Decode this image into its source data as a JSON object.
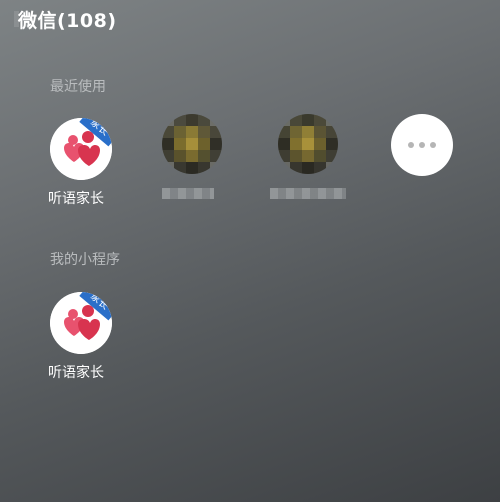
{
  "header": {
    "title": "微信(108)"
  },
  "recent": {
    "section_label": "最近使用",
    "apps": [
      {
        "name": "听语家长",
        "badge": "家长",
        "icon": "tingyu-parent-logo-icon"
      },
      {
        "name": "",
        "icon": "blurred-avatar-icon"
      },
      {
        "name": "",
        "icon": "blurred-avatar-icon"
      }
    ],
    "more_icon": "more-dots-icon"
  },
  "mine": {
    "section_label": "我的小程序",
    "apps": [
      {
        "name": "听语家长",
        "badge": "家长",
        "icon": "tingyu-parent-logo-icon"
      }
    ]
  },
  "colors": {
    "badge_blue": "#2a6fc9",
    "logo_pink": "#e8526e",
    "logo_red": "#d8344f"
  }
}
